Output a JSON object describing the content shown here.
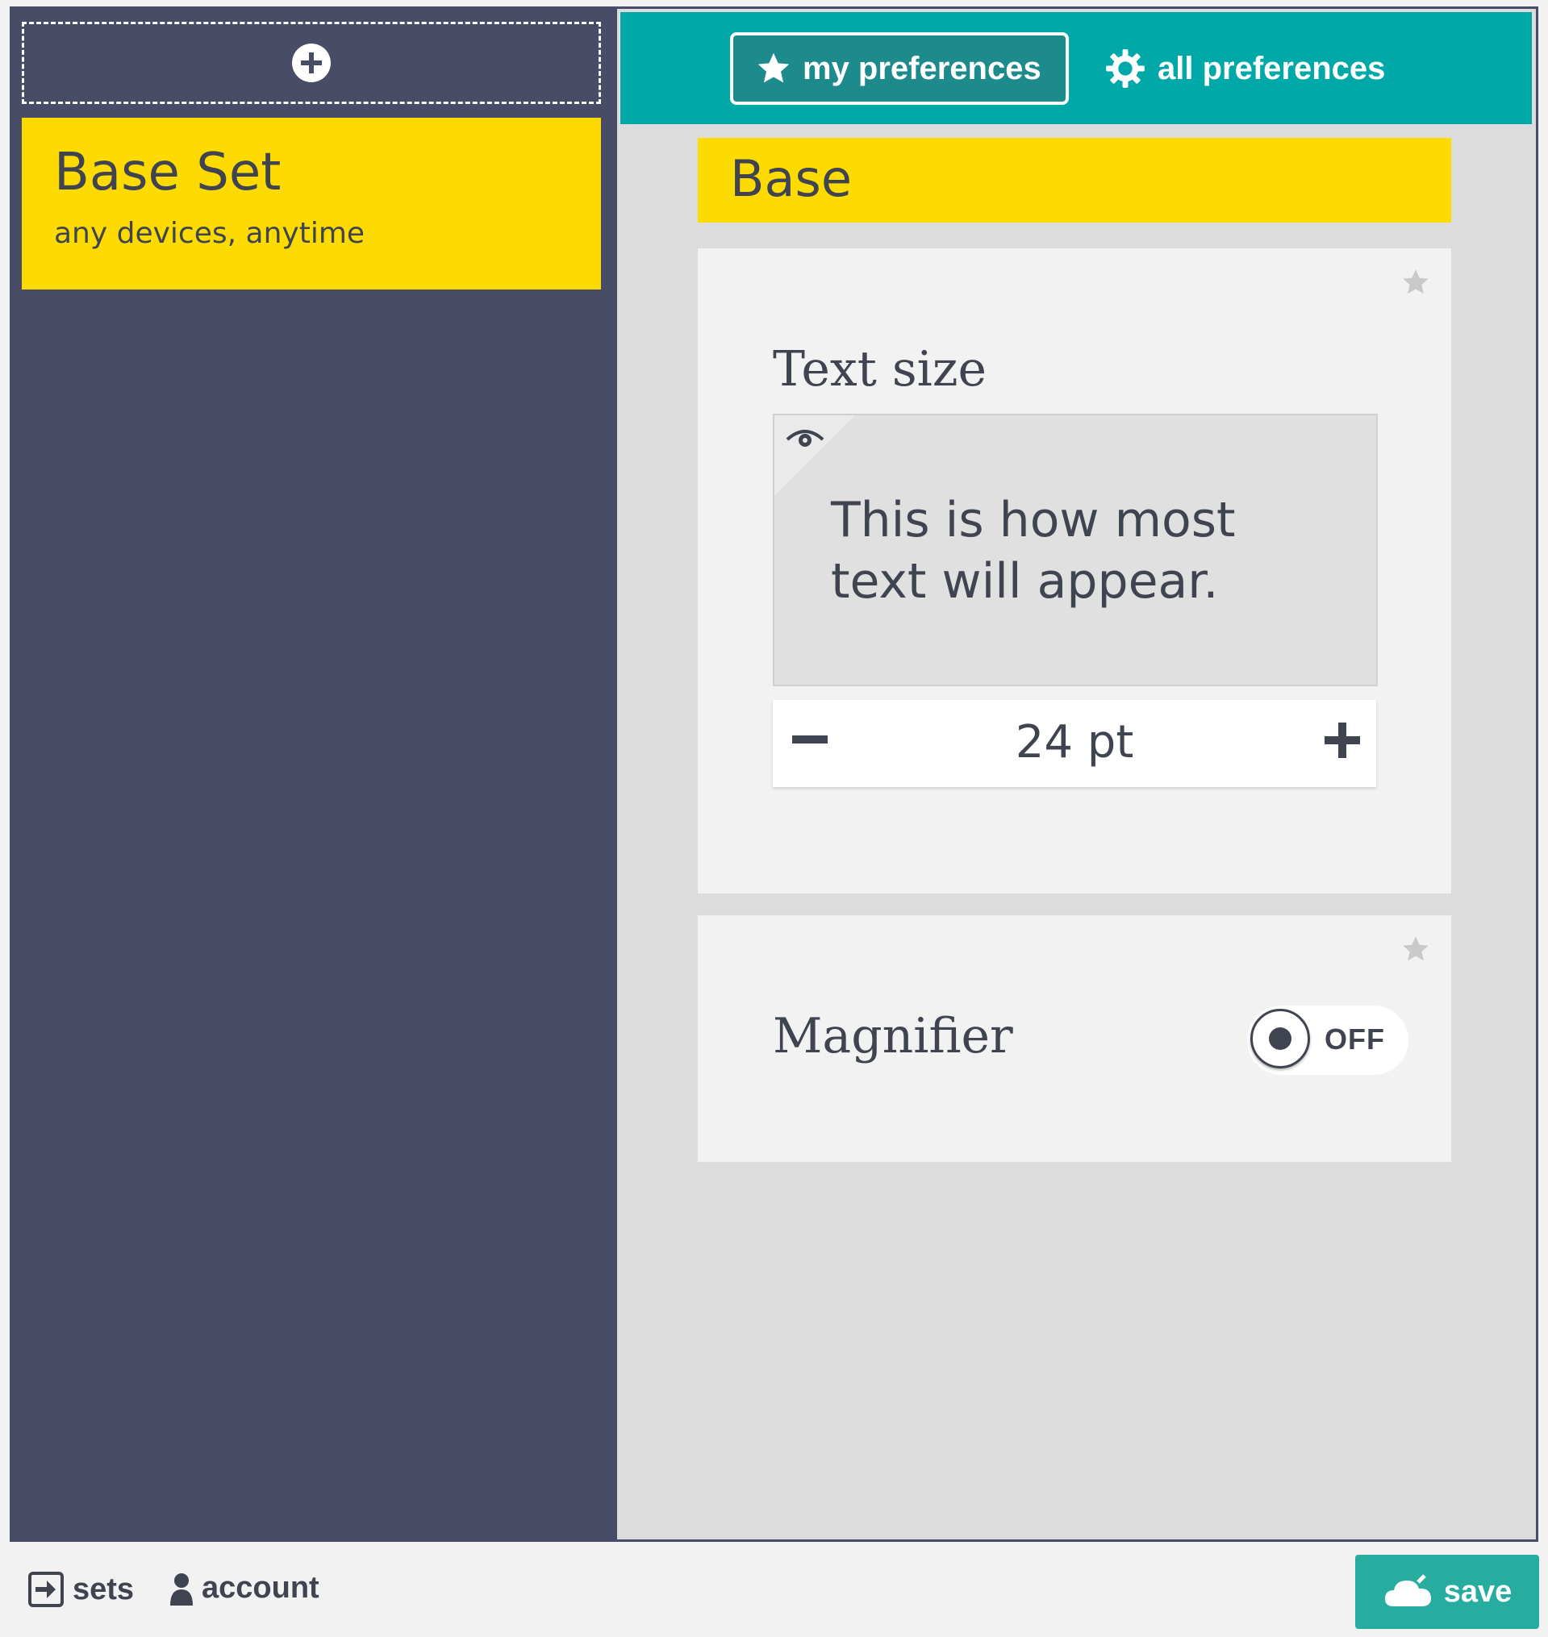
{
  "colors": {
    "sidebar_bg": "#484c66",
    "accent_yellow": "#fedb00",
    "topbar_teal": "#00a8a7",
    "save_green": "#27ad9f",
    "text_dark": "#3f4450"
  },
  "sidebar": {
    "add_icon": "plus-circle-icon",
    "sets": [
      {
        "title": "Base Set",
        "subtitle": "any devices, anytime"
      }
    ]
  },
  "tabs": {
    "my_preferences": {
      "label": "my preferences",
      "icon": "star-icon"
    },
    "all_preferences": {
      "label": "all preferences",
      "icon": "gear-icon"
    }
  },
  "section": {
    "title": "Base"
  },
  "preferences": {
    "text_size": {
      "label": "Text size",
      "preview_text": "This is how most text will appear.",
      "value": "24 pt"
    },
    "magnifier": {
      "label": "Magnifier",
      "state": "OFF"
    }
  },
  "footer": {
    "sets_label": "sets",
    "account_label": "account",
    "save_label": "save"
  }
}
